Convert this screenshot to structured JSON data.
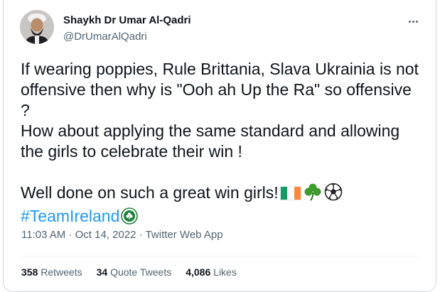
{
  "author": {
    "name": "Shaykh Dr Umar Al-Qadri",
    "handle": "@DrUmarAlQadri"
  },
  "tweet": {
    "lines": [
      "If wearing poppies, Rule Brittania, Slava Ukrainia is not",
      "offensive then why is \"Ooh ah Up the Ra\" so offensive",
      "?",
      "How about applying the same standard and allowing",
      "the girls to celebrate their win !",
      "Well done on such a great win girls!"
    ],
    "hashtag": "#TeamIreland",
    "emojis": [
      "irish-flag",
      "shamrock",
      "soccer-ball",
      "team-ireland-badge"
    ]
  },
  "meta": {
    "time": "11:03 AM",
    "separator": "·",
    "date": "Oct 14, 2022",
    "source": "Twitter Web App"
  },
  "stats": {
    "retweets_count": "358",
    "retweets_label": "Retweets",
    "quotes_count": "34",
    "quotes_label": "Quote Tweets",
    "likes_count": "4,086",
    "likes_label": "Likes"
  },
  "colors": {
    "text": "#0f1419",
    "muted": "#536471",
    "link": "#1d9bf0",
    "border": "#cfd9de"
  }
}
